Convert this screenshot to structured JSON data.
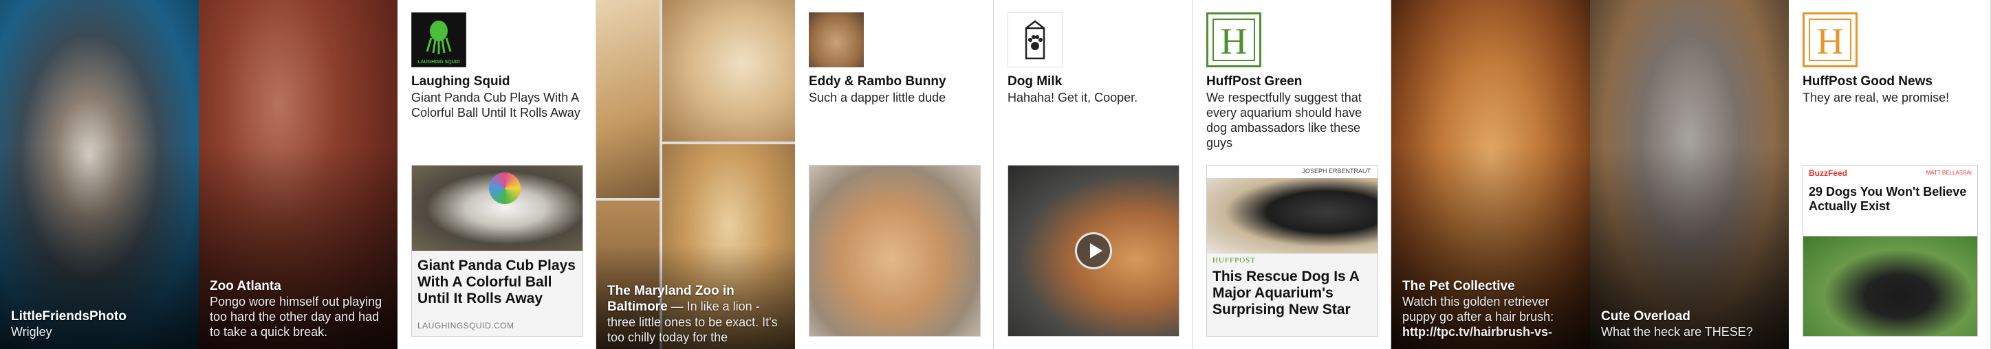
{
  "tiles": {
    "t1": {
      "name": "LittleFriendsPhoto",
      "text": "Wrigley"
    },
    "t2": {
      "name": "Zoo Atlanta",
      "text": "Pongo wore himself out playing too hard the other day and had to take a quick break."
    },
    "t3": {
      "source": "Laughing Squid",
      "logo_text": "LAUGHING SQUID",
      "message": "Giant Panda Cub Plays With A Colorful Ball Until It Rolls Away",
      "link_title": "Giant Panda Cub Plays With A Colorful Ball Until It Rolls Away",
      "link_url": "LAUGHINGSQUID.COM"
    },
    "t4": {
      "name": "The Maryland Zoo in Baltimore",
      "text": " — In like a lion - three little ones to be exact. It's too chilly today for the"
    },
    "t5": {
      "source": "Eddy & Rambo Bunny",
      "message": "Such a dapper little dude"
    },
    "t6": {
      "source": "Dog Milk",
      "message": "Hahaha! Get it, Cooper."
    },
    "t7": {
      "source": "HuffPost Green",
      "logo_letter": "H",
      "message": "We respectfully suggest that every aquarium should have dog ambassadors like these guys",
      "article_brand": "HUFFPOST",
      "article_author": "JOSEPH ERBENTRAUT",
      "link_title": "This Rescue Dog Is A Major Aquarium's Surprising New Star"
    },
    "t8": {
      "name": "The Pet Collective",
      "text": "Watch this golden retriever puppy go after a hair brush:",
      "link": "http://tpc.tv/hairbrush-vs-"
    },
    "t9": {
      "name": "Cute Overload",
      "text": "What the heck are THESE?"
    },
    "t10": {
      "source": "HuffPost Good News",
      "logo_letter": "H",
      "message": "They are real, we promise!",
      "article_brand": "BuzzFeed",
      "article_author": "MATT BELLASSAI",
      "link_title": "29 Dogs You Won't Believe Actually Exist"
    }
  },
  "colors": {
    "huffpost_green": "#4e8f2e",
    "huffpost_orange": "#e8952a",
    "buzzfeed_red": "#ee3322",
    "squid_green": "#4bbf3a"
  }
}
